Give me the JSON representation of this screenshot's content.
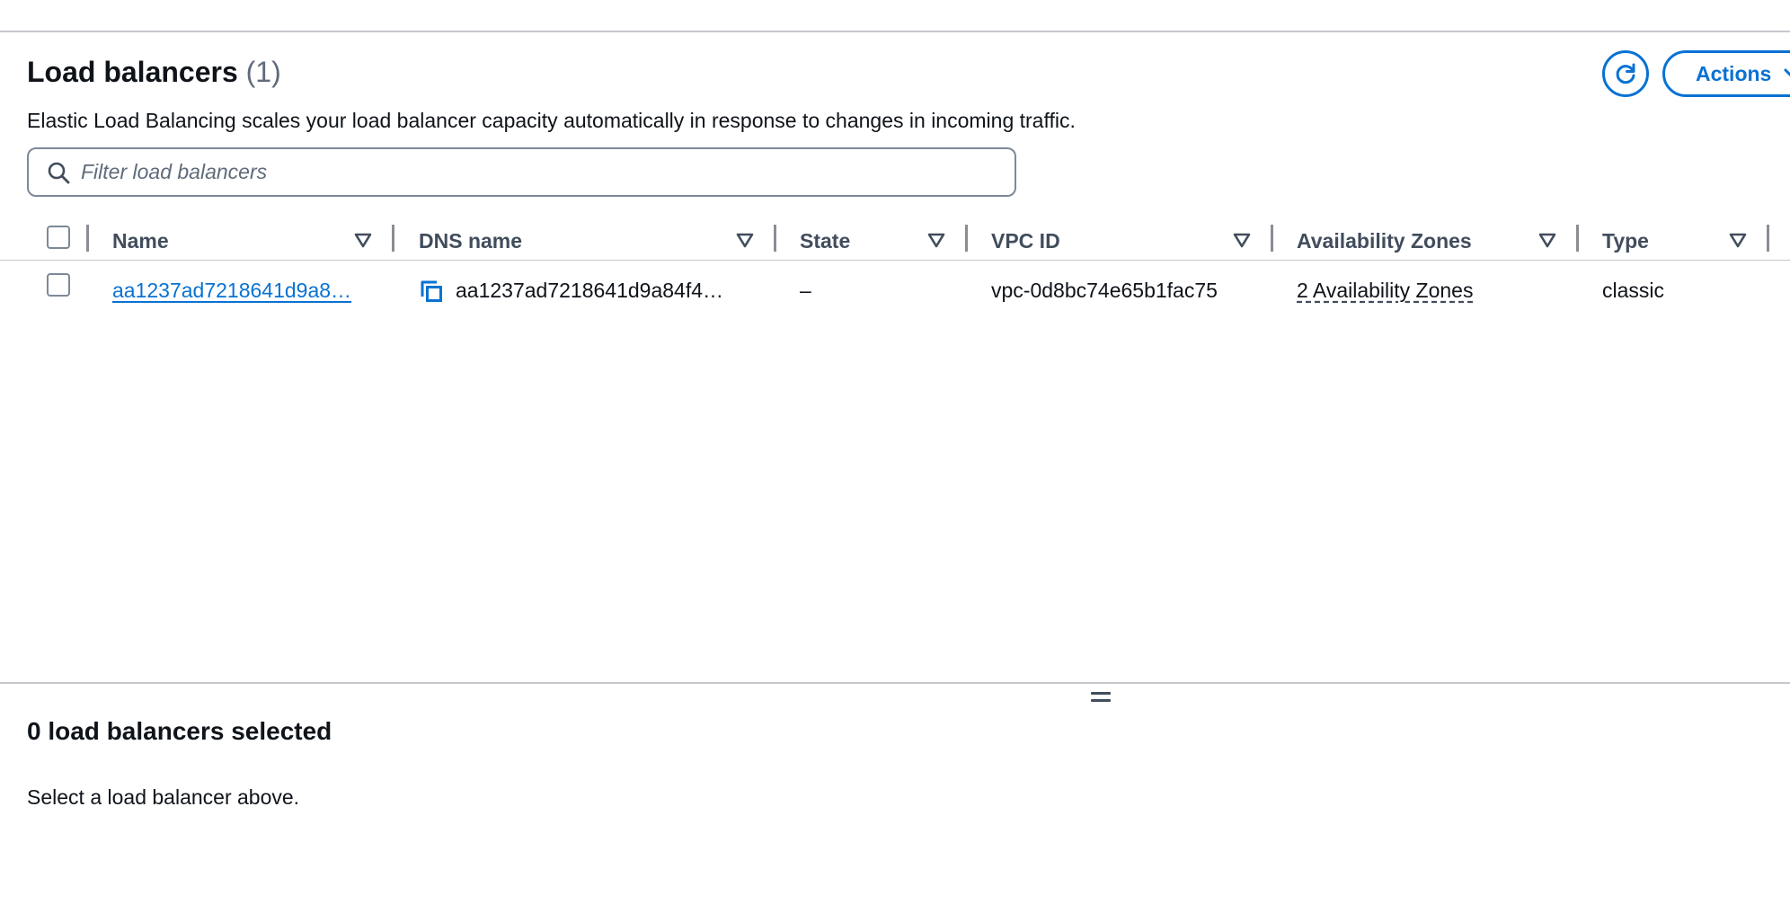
{
  "header": {
    "title": "Load balancers",
    "count": "(1)",
    "description": "Elastic Load Balancing scales your load balancer capacity automatically in response to changes in incoming traffic.",
    "actions_label": "Actions"
  },
  "filter": {
    "placeholder": "Filter load balancers",
    "value": ""
  },
  "table": {
    "columns": [
      "Name",
      "DNS name",
      "State",
      "VPC ID",
      "Availability Zones",
      "Type"
    ],
    "rows": [
      {
        "name": "aa1237ad7218641d9a8…",
        "dns_name": "aa1237ad7218641d9a84f4…",
        "state": "–",
        "vpc_id": "vpc-0d8bc74e65b1fac75",
        "availability_zones": "2 Availability Zones",
        "type": "classic",
        "selected": false
      }
    ]
  },
  "split_panel": {
    "title": "0 load balancers selected",
    "hint": "Select a load balancer above."
  },
  "icons": {
    "refresh": "refresh-icon",
    "actions_caret": "caret-down-icon",
    "search": "search-icon",
    "sort": "sort-caret-icon",
    "copy": "copy-icon",
    "drag": "drag-handle-icon"
  },
  "colors": {
    "accent": "#0972d3",
    "text": "#0f141a",
    "muted": "#5f6b7a",
    "border": "#7d8998",
    "divider": "#c6c6cd"
  }
}
